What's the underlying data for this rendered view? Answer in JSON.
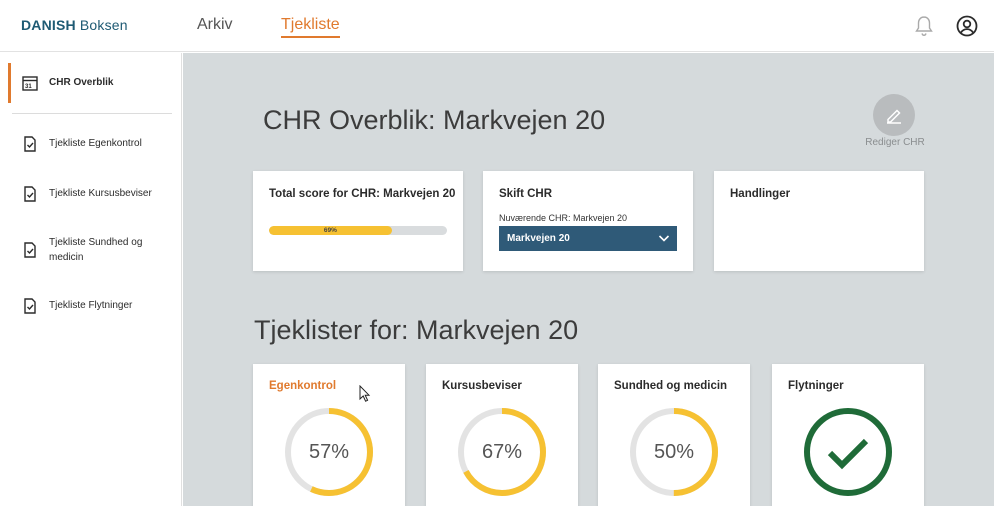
{
  "app": {
    "brand": "DANISH",
    "product": "Boksen"
  },
  "nav": {
    "arkiv": "Arkiv",
    "tjekliste": "Tjekliste"
  },
  "sidebar": {
    "items": [
      {
        "label": "CHR Overblik",
        "icon": "calendar-icon",
        "active": true
      },
      {
        "label": "Tjekliste Egenkontrol",
        "icon": "document-check-icon"
      },
      {
        "label": "Tjekliste Kursusbeviser",
        "icon": "document-check-icon"
      },
      {
        "label": "Tjekliste Sundhed og medicin",
        "icon": "document-check-icon"
      },
      {
        "label": "Tjekliste Flytninger",
        "icon": "document-check-icon"
      }
    ]
  },
  "main": {
    "title": "CHR Overblik: Markvejen 20",
    "edit_label": "Rediger CHR",
    "score_card": {
      "title": "Total score for CHR: Markvejen 20",
      "progress": 0.69,
      "progress_label": "69%"
    },
    "chr_card": {
      "title": "Skift CHR",
      "current_label": "Nuværende CHR: Markvejen 20",
      "selected": "Markvejen 20"
    },
    "actions_card": {
      "title": "Handlinger"
    },
    "section_title": "Tjeklister for: Markvejen 20",
    "checklists": [
      {
        "title": "Egenkontrol",
        "percent": 57,
        "label": "57%",
        "active": true
      },
      {
        "title": "Kursusbeviser",
        "percent": 67,
        "label": "67%"
      },
      {
        "title": "Sundhed og medicin",
        "percent": 50,
        "label": "50%"
      },
      {
        "title": "Flytninger",
        "percent": 100,
        "label": "",
        "complete": true
      }
    ]
  },
  "colors": {
    "accent": "#e07a2e",
    "brand": "#1e5a73",
    "select_bg": "#2f5a78",
    "progress": "#f6c132",
    "complete": "#1f6b38",
    "main_bg": "#d5dadc"
  }
}
